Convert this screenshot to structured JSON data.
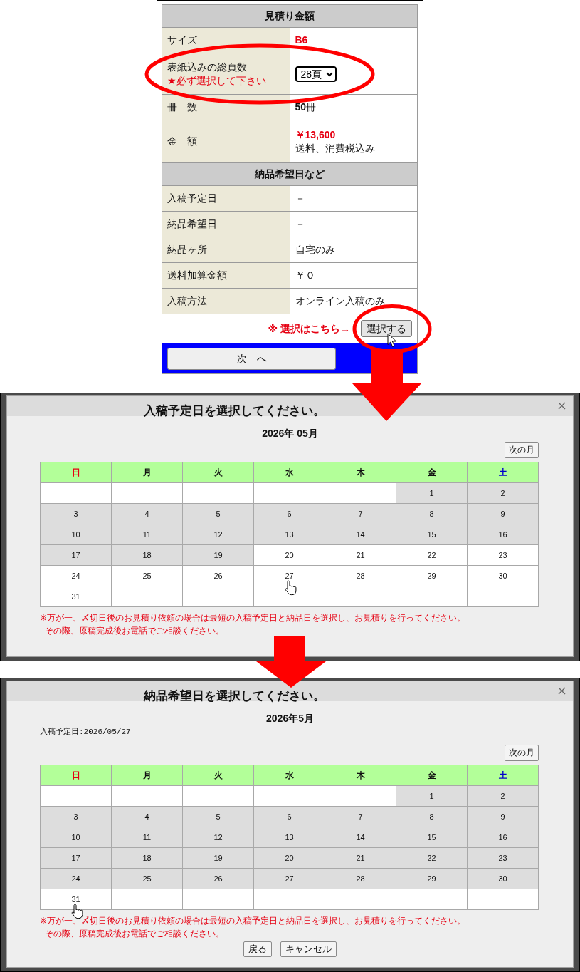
{
  "estimate_panel": {
    "sections": [
      {
        "title": "見積り金額",
        "rows": [
          {
            "label": "サイズ",
            "kind": "accent",
            "value": "B6"
          },
          {
            "label": "表紙込みの総頁数",
            "note": "★必ず選択して下さい",
            "kind": "select",
            "value": "28頁"
          },
          {
            "label": "冊　数",
            "kind": "plain",
            "value": "**50**冊"
          },
          {
            "label": "金　額",
            "kind": "price",
            "value": "￥13,600",
            "detail": "送料、消費税込み"
          }
        ]
      },
      {
        "title": "納品希望日など",
        "rows": [
          {
            "label": "入稿予定日",
            "kind": "plain",
            "value": "－"
          },
          {
            "label": "納品希望日",
            "kind": "plain",
            "value": "－"
          },
          {
            "label": "納品ヶ所",
            "kind": "plain",
            "value": "自宅のみ"
          },
          {
            "label": "送料加算金額",
            "kind": "plain",
            "value": "￥０"
          },
          {
            "label": "入稿方法",
            "kind": "plain",
            "value": "オンライン入稿のみ"
          }
        ]
      }
    ],
    "action": {
      "hint": "※ 選択はこちら→",
      "button": {
        "label": "選択する",
        "hovered": true
      }
    },
    "next_button": "次　へ"
  },
  "dialogs": [
    {
      "title": "入稿予定日を選択してください。",
      "month": "2026年 05月",
      "next_month_button": "次の月",
      "weekdays": [
        {
          "label": "日",
          "kind": "sunday"
        },
        {
          "label": "月",
          "kind": "weekday"
        },
        {
          "label": "火",
          "kind": "weekday"
        },
        {
          "label": "水",
          "kind": "weekday"
        },
        {
          "label": "木",
          "kind": "weekday"
        },
        {
          "label": "金",
          "kind": "weekday"
        },
        {
          "label": "土",
          "kind": "saturday"
        }
      ],
      "weeks": [
        [
          {
            "kind": "blank"
          },
          {
            "kind": "blank"
          },
          {
            "kind": "blank"
          },
          {
            "kind": "blank"
          },
          {
            "kind": "blank"
          },
          {
            "kind": "day",
            "day": "1",
            "available": false,
            "hovered": false
          },
          {
            "kind": "day",
            "day": "2",
            "available": false,
            "hovered": false
          }
        ],
        [
          {
            "kind": "day",
            "day": "3",
            "available": false,
            "hovered": false
          },
          {
            "kind": "day",
            "day": "4",
            "available": false,
            "hovered": false
          },
          {
            "kind": "day",
            "day": "5",
            "available": false,
            "hovered": false
          },
          {
            "kind": "day",
            "day": "6",
            "available": false,
            "hovered": false
          },
          {
            "kind": "day",
            "day": "7",
            "available": false,
            "hovered": false
          },
          {
            "kind": "day",
            "day": "8",
            "available": false,
            "hovered": false
          },
          {
            "kind": "day",
            "day": "9",
            "available": false,
            "hovered": false
          }
        ],
        [
          {
            "kind": "day",
            "day": "10",
            "available": false,
            "hovered": false
          },
          {
            "kind": "day",
            "day": "11",
            "available": false,
            "hovered": false
          },
          {
            "kind": "day",
            "day": "12",
            "available": false,
            "hovered": false
          },
          {
            "kind": "day",
            "day": "13",
            "available": false,
            "hovered": false
          },
          {
            "kind": "day",
            "day": "14",
            "available": false,
            "hovered": false
          },
          {
            "kind": "day",
            "day": "15",
            "available": false,
            "hovered": false
          },
          {
            "kind": "day",
            "day": "16",
            "available": false,
            "hovered": false
          }
        ],
        [
          {
            "kind": "day",
            "day": "17",
            "available": false,
            "hovered": false
          },
          {
            "kind": "day",
            "day": "18",
            "available": false,
            "hovered": false
          },
          {
            "kind": "day",
            "day": "19",
            "available": false,
            "hovered": false
          },
          {
            "kind": "day",
            "day": "20",
            "available": true,
            "hovered": false
          },
          {
            "kind": "day",
            "day": "21",
            "available": true,
            "hovered": false
          },
          {
            "kind": "day",
            "day": "22",
            "available": true,
            "hovered": false
          },
          {
            "kind": "day",
            "day": "23",
            "available": true,
            "hovered": false
          }
        ],
        [
          {
            "kind": "day",
            "day": "24",
            "available": true,
            "hovered": false
          },
          {
            "kind": "day",
            "day": "25",
            "available": true,
            "hovered": false
          },
          {
            "kind": "day",
            "day": "26",
            "available": true,
            "hovered": false
          },
          {
            "kind": "day",
            "day": "27",
            "available": true,
            "hovered": true
          },
          {
            "kind": "day",
            "day": "28",
            "available": true,
            "hovered": false
          },
          {
            "kind": "day",
            "day": "29",
            "available": true,
            "hovered": false
          },
          {
            "kind": "day",
            "day": "30",
            "available": true,
            "hovered": false
          }
        ],
        [
          {
            "kind": "day",
            "day": "31",
            "available": true,
            "hovered": false
          },
          {
            "kind": "blank"
          },
          {
            "kind": "blank"
          },
          {
            "kind": "blank"
          },
          {
            "kind": "blank"
          },
          {
            "kind": "blank"
          },
          {
            "kind": "blank"
          }
        ]
      ],
      "notes": [
        "※万が一、〆切日後のお見積り依頼の場合は最短の入稿予定日と納品日を選択し、お見積りを行ってください。",
        "その際、原稿完成後お電話でご相談ください。"
      ]
    },
    {
      "title": "納品希望日を選択してください。",
      "month": "2026年5月",
      "info": "入稿予定日:2026/05/27",
      "next_month_button": "次の月",
      "weekdays": [
        {
          "label": "日",
          "kind": "sunday"
        },
        {
          "label": "月",
          "kind": "weekday"
        },
        {
          "label": "火",
          "kind": "weekday"
        },
        {
          "label": "水",
          "kind": "weekday"
        },
        {
          "label": "木",
          "kind": "weekday"
        },
        {
          "label": "金",
          "kind": "weekday"
        },
        {
          "label": "土",
          "kind": "saturday"
        }
      ],
      "weeks": [
        [
          {
            "kind": "blank"
          },
          {
            "kind": "blank"
          },
          {
            "kind": "blank"
          },
          {
            "kind": "blank"
          },
          {
            "kind": "blank"
          },
          {
            "kind": "day",
            "day": "1",
            "available": false,
            "hovered": false
          },
          {
            "kind": "day",
            "day": "2",
            "available": false,
            "hovered": false
          }
        ],
        [
          {
            "kind": "day",
            "day": "3",
            "available": false,
            "hovered": false
          },
          {
            "kind": "day",
            "day": "4",
            "available": false,
            "hovered": false
          },
          {
            "kind": "day",
            "day": "5",
            "available": false,
            "hovered": false
          },
          {
            "kind": "day",
            "day": "6",
            "available": false,
            "hovered": false
          },
          {
            "kind": "day",
            "day": "7",
            "available": false,
            "hovered": false
          },
          {
            "kind": "day",
            "day": "8",
            "available": false,
            "hovered": false
          },
          {
            "kind": "day",
            "day": "9",
            "available": false,
            "hovered": false
          }
        ],
        [
          {
            "kind": "day",
            "day": "10",
            "available": false,
            "hovered": false
          },
          {
            "kind": "day",
            "day": "11",
            "available": false,
            "hovered": false
          },
          {
            "kind": "day",
            "day": "12",
            "available": false,
            "hovered": false
          },
          {
            "kind": "day",
            "day": "13",
            "available": false,
            "hovered": false
          },
          {
            "kind": "day",
            "day": "14",
            "available": false,
            "hovered": false
          },
          {
            "kind": "day",
            "day": "15",
            "available": false,
            "hovered": false
          },
          {
            "kind": "day",
            "day": "16",
            "available": false,
            "hovered": false
          }
        ],
        [
          {
            "kind": "day",
            "day": "17",
            "available": false,
            "hovered": false
          },
          {
            "kind": "day",
            "day": "18",
            "available": false,
            "hovered": false
          },
          {
            "kind": "day",
            "day": "19",
            "available": false,
            "hovered": false
          },
          {
            "kind": "day",
            "day": "20",
            "available": false,
            "hovered": false
          },
          {
            "kind": "day",
            "day": "21",
            "available": false,
            "hovered": false
          },
          {
            "kind": "day",
            "day": "22",
            "available": false,
            "hovered": false
          },
          {
            "kind": "day",
            "day": "23",
            "available": false,
            "hovered": false
          }
        ],
        [
          {
            "kind": "day",
            "day": "24",
            "available": false,
            "hovered": false
          },
          {
            "kind": "day",
            "day": "25",
            "available": false,
            "hovered": false
          },
          {
            "kind": "day",
            "day": "26",
            "available": false,
            "hovered": false
          },
          {
            "kind": "day",
            "day": "27",
            "available": false,
            "hovered": false
          },
          {
            "kind": "day",
            "day": "28",
            "available": false,
            "hovered": false
          },
          {
            "kind": "day",
            "day": "29",
            "available": false,
            "hovered": false
          },
          {
            "kind": "day",
            "day": "30",
            "available": false,
            "hovered": false
          }
        ],
        [
          {
            "kind": "day",
            "day": "31",
            "available": true,
            "hovered": true
          },
          {
            "kind": "blank"
          },
          {
            "kind": "blank"
          },
          {
            "kind": "blank"
          },
          {
            "kind": "blank"
          },
          {
            "kind": "blank"
          },
          {
            "kind": "blank"
          }
        ]
      ],
      "notes": [
        "※万が一、〆切日後のお見積り依頼の場合は最短の入稿予定日と納品日を選択し、お見積りを行ってください。",
        "その際、原稿完成後お電話でご相談ください。"
      ],
      "buttons": [
        "戻る",
        "キャンセル"
      ]
    }
  ]
}
